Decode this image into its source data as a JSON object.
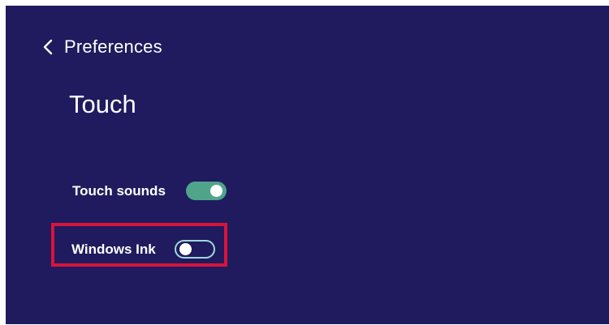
{
  "header": {
    "back_icon": "chevron-left-icon",
    "back_label": "Preferences"
  },
  "page": {
    "title": "Touch"
  },
  "settings": [
    {
      "label": "Touch sounds",
      "enabled": true
    },
    {
      "label": "Windows Ink",
      "enabled": false,
      "highlighted": true
    }
  ],
  "colors": {
    "background": "#1f1b5e",
    "text": "#ffffff",
    "toggle_on": "#4fa48a",
    "toggle_off_border": "#9fd7de",
    "highlight": "#d9143b"
  }
}
